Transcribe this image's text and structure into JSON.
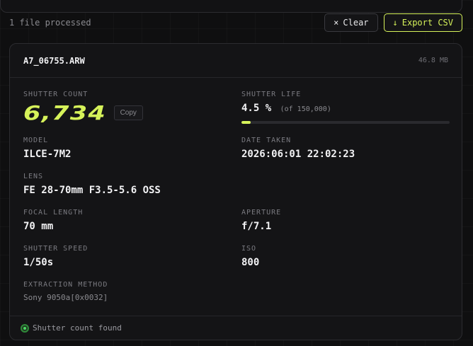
{
  "toolbar": {
    "status": "1 file processed",
    "clear_label": "Clear",
    "clear_icon": "×",
    "export_label": "Export CSV",
    "export_icon": "↓"
  },
  "file": {
    "name": "A7_06755.ARW",
    "size": "46.8 MB"
  },
  "fields": {
    "shutter_count_label": "SHUTTER COUNT",
    "shutter_count": "6,734",
    "copy_label": "Copy",
    "shutter_life_label": "SHUTTER LIFE",
    "shutter_life_value": "4.5 %",
    "shutter_life_of": "(of 150,000)",
    "shutter_life_percent": 4.5,
    "model_label": "MODEL",
    "model": "ILCE-7M2",
    "date_label": "DATE TAKEN",
    "date": "2026:06:01 22:02:23",
    "lens_label": "LENS",
    "lens": "FE 28-70mm F3.5-5.6 OSS",
    "focal_label": "FOCAL LENGTH",
    "focal": "70 mm",
    "aperture_label": "APERTURE",
    "aperture": "f/7.1",
    "speed_label": "SHUTTER SPEED",
    "speed": "1/50s",
    "iso_label": "ISO",
    "iso": "800",
    "method_label": "EXTRACTION METHOD",
    "method": "Sony 9050a[0x0032]"
  },
  "footer": {
    "status": "Shutter count found"
  },
  "colors": {
    "accent": "#d6f25a",
    "success": "#4cd964"
  }
}
